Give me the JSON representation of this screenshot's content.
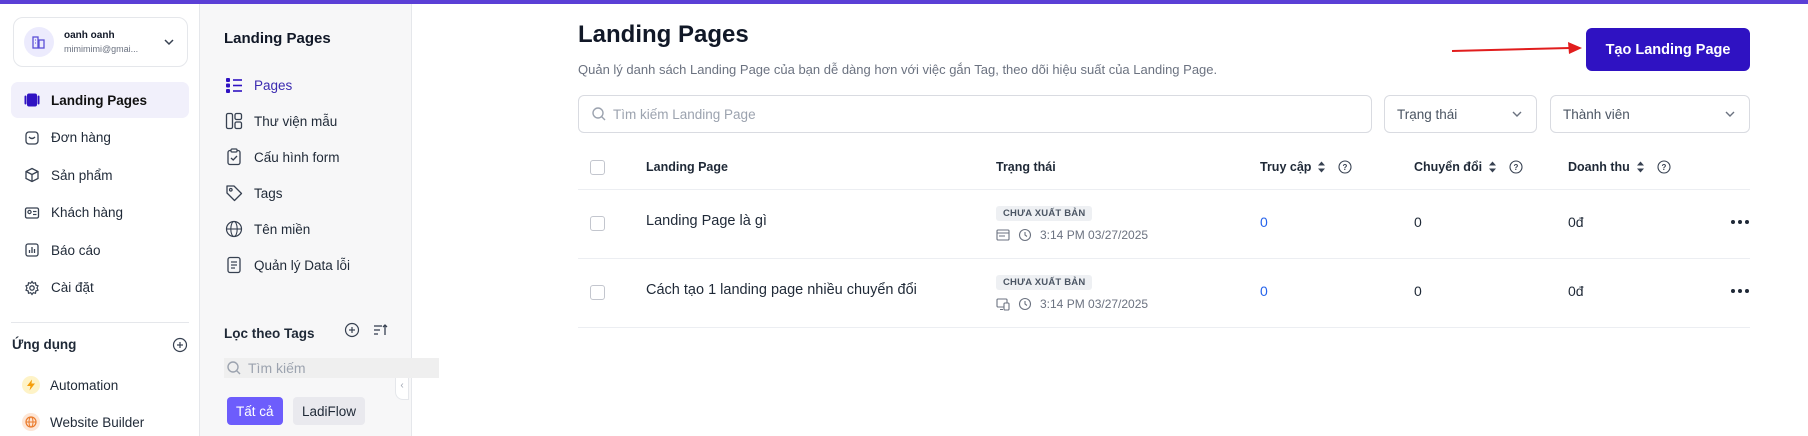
{
  "account": {
    "name": "oanh oanh",
    "email": "mimimimi@gmai..."
  },
  "nav": [
    {
      "label": "Landing Pages",
      "icon": "landing-pages-icon",
      "active": true
    },
    {
      "label": "Đơn hàng",
      "icon": "orders-icon"
    },
    {
      "label": "Sản phẩm",
      "icon": "box-icon"
    },
    {
      "label": "Khách hàng",
      "icon": "contact-card-icon"
    },
    {
      "label": "Báo cáo",
      "icon": "report-chart-icon"
    },
    {
      "label": "Cài đặt",
      "icon": "gear-icon"
    }
  ],
  "apps": {
    "title": "Ứng dụng",
    "items": [
      {
        "label": "Automation",
        "icon": "lightning-icon",
        "color": "#f59e0b"
      },
      {
        "label": "Website Builder",
        "icon": "globe-icon",
        "color": "#ea7a2a"
      }
    ]
  },
  "sub": {
    "title": "Landing Pages",
    "items": [
      {
        "label": "Pages",
        "icon": "list-icon",
        "active": true
      },
      {
        "label": "Thư viện mẫu",
        "icon": "template-library-icon"
      },
      {
        "label": "Cấu hình form",
        "icon": "form-config-icon"
      },
      {
        "label": "Tags",
        "icon": "tag-icon"
      },
      {
        "label": "Tên miền",
        "icon": "domain-globe-icon"
      },
      {
        "label": "Quản lý Data lỗi",
        "icon": "error-data-icon"
      }
    ],
    "tags_title": "Lọc theo Tags",
    "tag_search_placeholder": "Tìm kiếm",
    "chips": [
      "Tất cả",
      "LadiFlow"
    ]
  },
  "main": {
    "title": "Landing Pages",
    "subtitle": "Quản lý danh sách Landing Page của bạn dễ dàng hơn với việc gắn Tag, theo dõi hiệu suất của Landing Page.",
    "create_label": "Tạo Landing Page",
    "search_placeholder": "Tìm kiếm Landing Page",
    "status_filter": "Trạng thái",
    "member_filter": "Thành viên",
    "accent": "#2f12c2"
  },
  "table": {
    "columns": [
      "Landing Page",
      "Trạng thái",
      "Truy cập",
      "Chuyển đổi",
      "Doanh thu"
    ],
    "rows": [
      {
        "name": "Landing Page là gì",
        "status": "CHƯA XUẤT BẢN",
        "time": "3:14 PM 03/27/2025",
        "visits": "0",
        "conversions": "0",
        "revenue": "0đ"
      },
      {
        "name": "Cách tạo 1 landing page nhiều chuyển đổi",
        "status": "CHƯA XUẤT BẢN",
        "time": "3:14 PM 03/27/2025",
        "visits": "0",
        "conversions": "0",
        "revenue": "0đ"
      }
    ]
  }
}
